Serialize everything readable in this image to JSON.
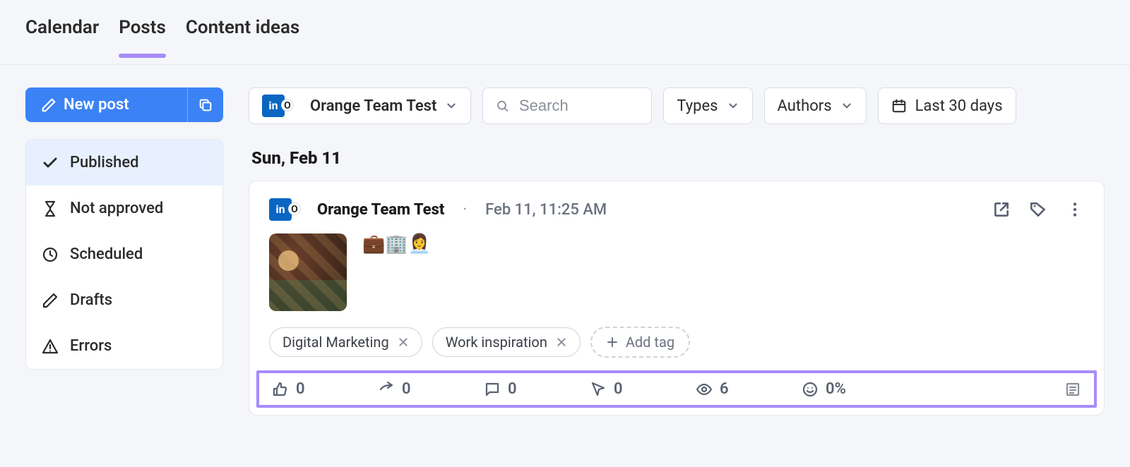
{
  "tabs": {
    "calendar": "Calendar",
    "posts": "Posts",
    "content_ideas": "Content ideas",
    "active": "posts"
  },
  "newpost": {
    "label": "New post"
  },
  "statuses": {
    "published": "Published",
    "not_approved": "Not approved",
    "scheduled": "Scheduled",
    "drafts": "Drafts",
    "errors": "Errors",
    "active": "published"
  },
  "filters": {
    "profile_name": "Orange Team Test",
    "search_placeholder": "Search",
    "types": "Types",
    "authors": "Authors",
    "date_range": "Last 30 days"
  },
  "feed": {
    "date_header": "Sun, Feb 11",
    "post": {
      "profile_name": "Orange Team Test",
      "timestamp": "Feb 11, 11:25 AM",
      "emoji_text": "💼🏢👩‍💼",
      "tags": {
        "tag1": "Digital Marketing",
        "tag2": "Work inspiration",
        "add_tag_label": "Add tag"
      },
      "stats": {
        "likes": "0",
        "shares": "0",
        "comments": "0",
        "clicks": "0",
        "views": "6",
        "engagement_rate": "0%"
      }
    }
  }
}
